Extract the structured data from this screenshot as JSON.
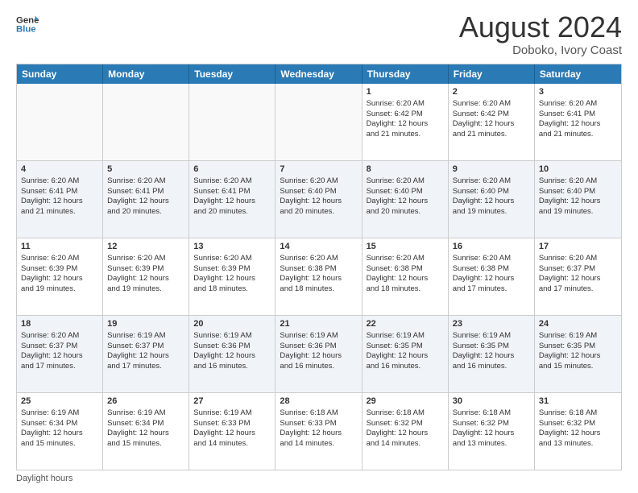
{
  "header": {
    "logo_line1": "General",
    "logo_line2": "Blue",
    "month_year": "August 2024",
    "location": "Doboko, Ivory Coast"
  },
  "days_of_week": [
    "Sunday",
    "Monday",
    "Tuesday",
    "Wednesday",
    "Thursday",
    "Friday",
    "Saturday"
  ],
  "footer": {
    "daylight_label": "Daylight hours"
  },
  "weeks": [
    [
      {
        "day": "",
        "info": ""
      },
      {
        "day": "",
        "info": ""
      },
      {
        "day": "",
        "info": ""
      },
      {
        "day": "",
        "info": ""
      },
      {
        "day": "1",
        "info": "Sunrise: 6:20 AM\nSunset: 6:42 PM\nDaylight: 12 hours\nand 21 minutes."
      },
      {
        "day": "2",
        "info": "Sunrise: 6:20 AM\nSunset: 6:42 PM\nDaylight: 12 hours\nand 21 minutes."
      },
      {
        "day": "3",
        "info": "Sunrise: 6:20 AM\nSunset: 6:41 PM\nDaylight: 12 hours\nand 21 minutes."
      }
    ],
    [
      {
        "day": "4",
        "info": "Sunrise: 6:20 AM\nSunset: 6:41 PM\nDaylight: 12 hours\nand 21 minutes."
      },
      {
        "day": "5",
        "info": "Sunrise: 6:20 AM\nSunset: 6:41 PM\nDaylight: 12 hours\nand 20 minutes."
      },
      {
        "day": "6",
        "info": "Sunrise: 6:20 AM\nSunset: 6:41 PM\nDaylight: 12 hours\nand 20 minutes."
      },
      {
        "day": "7",
        "info": "Sunrise: 6:20 AM\nSunset: 6:40 PM\nDaylight: 12 hours\nand 20 minutes."
      },
      {
        "day": "8",
        "info": "Sunrise: 6:20 AM\nSunset: 6:40 PM\nDaylight: 12 hours\nand 20 minutes."
      },
      {
        "day": "9",
        "info": "Sunrise: 6:20 AM\nSunset: 6:40 PM\nDaylight: 12 hours\nand 19 minutes."
      },
      {
        "day": "10",
        "info": "Sunrise: 6:20 AM\nSunset: 6:40 PM\nDaylight: 12 hours\nand 19 minutes."
      }
    ],
    [
      {
        "day": "11",
        "info": "Sunrise: 6:20 AM\nSunset: 6:39 PM\nDaylight: 12 hours\nand 19 minutes."
      },
      {
        "day": "12",
        "info": "Sunrise: 6:20 AM\nSunset: 6:39 PM\nDaylight: 12 hours\nand 19 minutes."
      },
      {
        "day": "13",
        "info": "Sunrise: 6:20 AM\nSunset: 6:39 PM\nDaylight: 12 hours\nand 18 minutes."
      },
      {
        "day": "14",
        "info": "Sunrise: 6:20 AM\nSunset: 6:38 PM\nDaylight: 12 hours\nand 18 minutes."
      },
      {
        "day": "15",
        "info": "Sunrise: 6:20 AM\nSunset: 6:38 PM\nDaylight: 12 hours\nand 18 minutes."
      },
      {
        "day": "16",
        "info": "Sunrise: 6:20 AM\nSunset: 6:38 PM\nDaylight: 12 hours\nand 17 minutes."
      },
      {
        "day": "17",
        "info": "Sunrise: 6:20 AM\nSunset: 6:37 PM\nDaylight: 12 hours\nand 17 minutes."
      }
    ],
    [
      {
        "day": "18",
        "info": "Sunrise: 6:20 AM\nSunset: 6:37 PM\nDaylight: 12 hours\nand 17 minutes."
      },
      {
        "day": "19",
        "info": "Sunrise: 6:19 AM\nSunset: 6:37 PM\nDaylight: 12 hours\nand 17 minutes."
      },
      {
        "day": "20",
        "info": "Sunrise: 6:19 AM\nSunset: 6:36 PM\nDaylight: 12 hours\nand 16 minutes."
      },
      {
        "day": "21",
        "info": "Sunrise: 6:19 AM\nSunset: 6:36 PM\nDaylight: 12 hours\nand 16 minutes."
      },
      {
        "day": "22",
        "info": "Sunrise: 6:19 AM\nSunset: 6:35 PM\nDaylight: 12 hours\nand 16 minutes."
      },
      {
        "day": "23",
        "info": "Sunrise: 6:19 AM\nSunset: 6:35 PM\nDaylight: 12 hours\nand 16 minutes."
      },
      {
        "day": "24",
        "info": "Sunrise: 6:19 AM\nSunset: 6:35 PM\nDaylight: 12 hours\nand 15 minutes."
      }
    ],
    [
      {
        "day": "25",
        "info": "Sunrise: 6:19 AM\nSunset: 6:34 PM\nDaylight: 12 hours\nand 15 minutes."
      },
      {
        "day": "26",
        "info": "Sunrise: 6:19 AM\nSunset: 6:34 PM\nDaylight: 12 hours\nand 15 minutes."
      },
      {
        "day": "27",
        "info": "Sunrise: 6:19 AM\nSunset: 6:33 PM\nDaylight: 12 hours\nand 14 minutes."
      },
      {
        "day": "28",
        "info": "Sunrise: 6:18 AM\nSunset: 6:33 PM\nDaylight: 12 hours\nand 14 minutes."
      },
      {
        "day": "29",
        "info": "Sunrise: 6:18 AM\nSunset: 6:32 PM\nDaylight: 12 hours\nand 14 minutes."
      },
      {
        "day": "30",
        "info": "Sunrise: 6:18 AM\nSunset: 6:32 PM\nDaylight: 12 hours\nand 13 minutes."
      },
      {
        "day": "31",
        "info": "Sunrise: 6:18 AM\nSunset: 6:32 PM\nDaylight: 12 hours\nand 13 minutes."
      }
    ]
  ]
}
